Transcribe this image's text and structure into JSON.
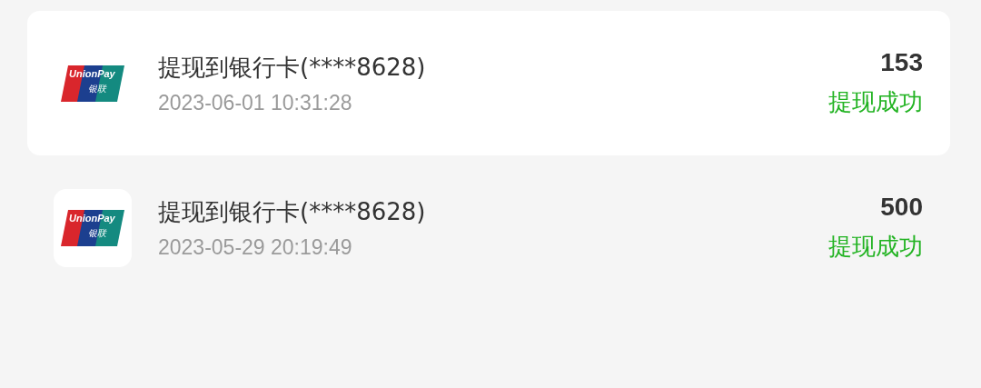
{
  "transactions": [
    {
      "kind": "card",
      "logo_text": "UnionPay",
      "logo_subtext": "银联",
      "title": "提现到银行卡(****8628)",
      "time": "2023-06-01 10:31:28",
      "amount": "153",
      "status": "提现成功"
    },
    {
      "kind": "plain",
      "logo_text": "UnionPay",
      "logo_subtext": "银联",
      "title": "提现到银行卡(****8628)",
      "time": "2023-05-29 20:19:49",
      "amount": "500",
      "status": "提现成功"
    }
  ]
}
